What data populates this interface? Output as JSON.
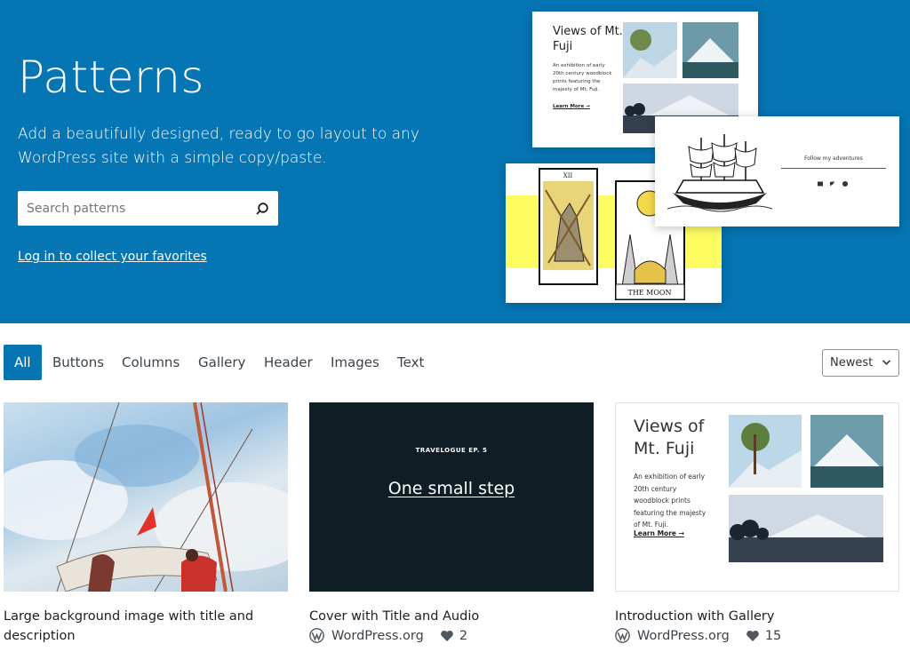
{
  "hero": {
    "title": "Patterns",
    "description": "Add a beautifully designed, ready to go layout to any WordPress site with a simple copy/paste.",
    "search_placeholder": "Search patterns",
    "login_link": "Log in to collect your favorites",
    "background_color": "#0675b4",
    "collage": {
      "gallery_card": {
        "title": "Views of Mt. Fuji",
        "text": "An exhibition of early 20th century woodblock prints featuring the majesty of Mt. Fuji.",
        "link": "Learn More →"
      },
      "social_card": {
        "text": "Follow my adventures",
        "icons": [
          "mail-icon",
          "twitter-icon",
          "facebook-icon"
        ]
      },
      "tarot_card": {
        "left_numeral": "XII",
        "right_label": "THE MOON",
        "accent_color": "#fdfc61"
      }
    }
  },
  "filters": {
    "items": [
      "All",
      "Buttons",
      "Columns",
      "Gallery",
      "Header",
      "Images",
      "Text"
    ],
    "active": "All",
    "sort": {
      "selected": "Newest",
      "icon": "chevron-down-icon"
    }
  },
  "patterns": [
    {
      "title": "Large background image with title and description",
      "author": "",
      "likes": ""
    },
    {
      "title": "Cover with Title and Audio",
      "author": "WordPress.org",
      "likes": "2",
      "preview": {
        "eyebrow": "TRAVELOGUE EP. 5",
        "heading": "One small step"
      }
    },
    {
      "title": "Introduction with Gallery",
      "author": "WordPress.org",
      "likes": "15",
      "preview": {
        "title": "Views of Mt. Fuji",
        "text": "An exhibition of early 20th century woodblock prints featuring the majesty of Mt. Fuji.",
        "link": "Learn More →"
      }
    }
  ],
  "colors": {
    "accent": "#0675b4",
    "text": "#1e1e1e",
    "muted": "#3c434a"
  }
}
